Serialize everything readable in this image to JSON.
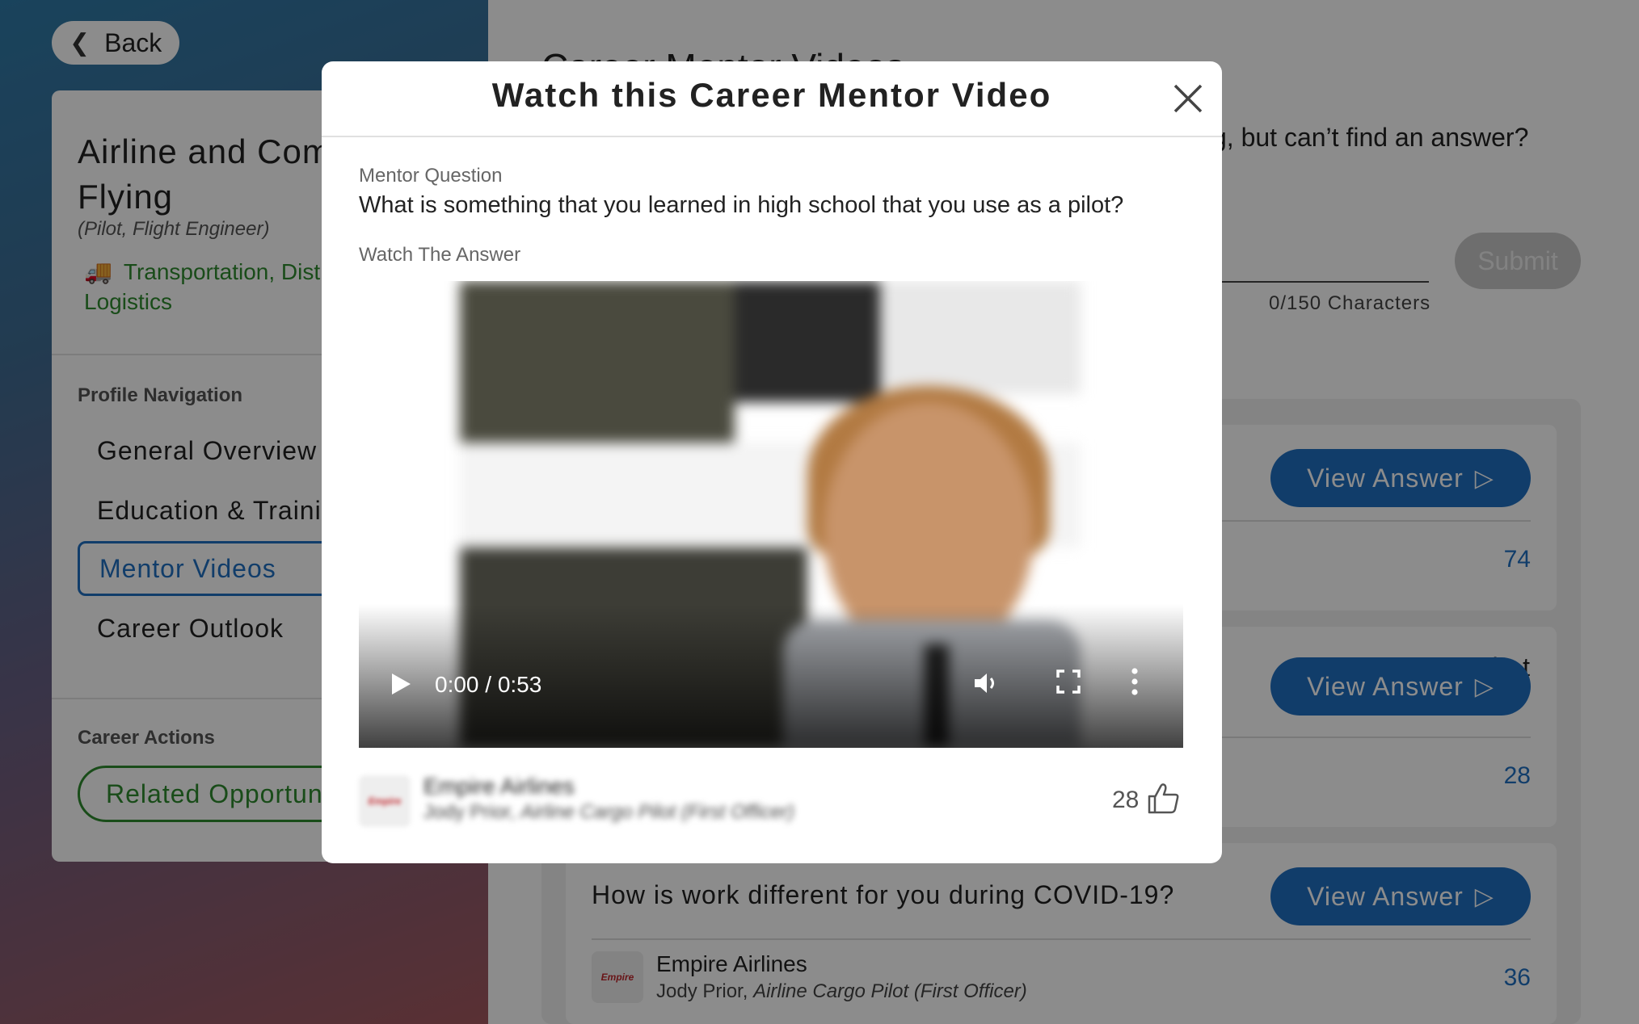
{
  "back": {
    "label": "Back"
  },
  "career": {
    "title": "Airline and Commercial Flying",
    "subtitle": "(Pilot, Flight Engineer)",
    "category": "Transportation, Distribution and Logistics"
  },
  "profile_nav": {
    "label": "Profile Navigation",
    "items": [
      {
        "label": "General Overview"
      },
      {
        "label": "Education & Training"
      },
      {
        "label": "Mentor Videos",
        "active": true
      },
      {
        "label": "Career Outlook"
      }
    ]
  },
  "career_actions": {
    "label": "Career Actions",
    "related_label": "Related Opportunities"
  },
  "main": {
    "heading": "Career Mentor Videos",
    "ask_prompt": "g, but can’t find an answer?",
    "char_count": "0/150 Characters",
    "submit_label": "Submit"
  },
  "questions": [
    {
      "text": "",
      "view_label": "View Answer",
      "likes": "74"
    },
    {
      "text": "hat",
      "view_label": "View Answer",
      "likes": "28"
    },
    {
      "text": "How is work different for you during COVID-19?",
      "view_label": "View Answer",
      "likes": "36",
      "company": "Empire Airlines",
      "mentor_name": "Jody Prior,",
      "mentor_role": "Airline Cargo Pilot (First Officer)"
    }
  ],
  "modal": {
    "title": "Watch this Career Mentor Video",
    "question_label": "Mentor Question",
    "question": "What is something that you learned in high school that you use as a pilot?",
    "answer_label": "Watch The Answer",
    "video": {
      "time": "0:00 / 0:53",
      "progress": 0.04
    },
    "footer": {
      "company": "Empire Airlines",
      "mentor_name": "Jody Prior,",
      "mentor_role": "Airline Cargo Pilot (First Officer)",
      "likes": "28"
    }
  },
  "colors": {
    "accent_blue": "#1f6fc2",
    "accent_green": "#2e8b2e"
  }
}
